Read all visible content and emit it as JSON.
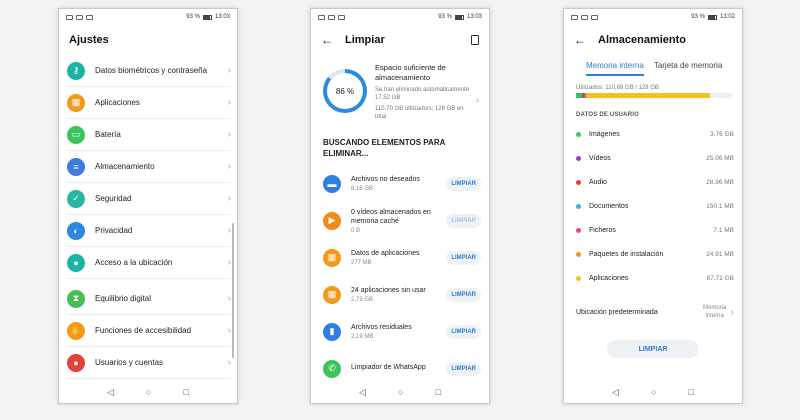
{
  "phone1": {
    "status_time": "13:03",
    "status_battery": "93 %",
    "title": "Ajustes",
    "items": [
      {
        "label": "Datos biométricos y contraseña",
        "icon": "key-icon",
        "color": "#1fb3a8"
      },
      {
        "label": "Aplicaciones",
        "icon": "apps-icon",
        "color": "#f39a1b"
      },
      {
        "label": "Batería",
        "icon": "battery-icon",
        "color": "#3cc45c"
      },
      {
        "label": "Almacenamiento",
        "icon": "storage-icon",
        "color": "#3d7be0"
      },
      {
        "label": "Seguridad",
        "icon": "shield-icon",
        "color": "#2bb5a3"
      },
      {
        "label": "Privacidad",
        "icon": "privacy-icon",
        "color": "#2f86e0"
      },
      {
        "label": "Acceso a la ubicación",
        "icon": "location-icon",
        "color": "#1fb3a8"
      },
      {
        "label": "Equilibrio digital",
        "icon": "hourglass-icon",
        "color": "#44bf55"
      },
      {
        "label": "Funciones de accesibilidad",
        "icon": "hand-icon",
        "color": "#f39a1b"
      },
      {
        "label": "Usuarios y cuentas",
        "icon": "user-icon",
        "color": "#e5413b"
      }
    ]
  },
  "phone2": {
    "status_time": "13:03",
    "status_battery": "93 %",
    "title": "Limpiar",
    "percent": "86 %",
    "summary_title": "Espacio suficiente de almacenamiento",
    "summary_sub1": "Se han eliminado automáticamente 17,52 GB",
    "summary_sub2": "110,70 GB utilizado/s; 128 GB en total",
    "section": "BUSCANDO ELEMENTOS PARA ELIMINAR...",
    "button_label": "LIMPIAR",
    "items": [
      {
        "label": "Archivos no deseados",
        "size": "8,16 GB",
        "icon": "folder-icon",
        "color": "#2f7fe0",
        "enabled": true
      },
      {
        "label": "0 vídeos almacenados en memoria caché",
        "size": "0 B",
        "icon": "video-icon",
        "color": "#f38b1b",
        "enabled": false
      },
      {
        "label": "Datos de aplicaciones",
        "size": "277 MB",
        "icon": "apps-icon",
        "color": "#f39a1b",
        "enabled": true
      },
      {
        "label": "24 aplicaciones sin usar",
        "size": "2,79 GB",
        "icon": "apps-icon",
        "color": "#f39a1b",
        "enabled": true
      },
      {
        "label": "Archivos residuales",
        "size": "2,19 MB",
        "icon": "trash-icon",
        "color": "#2f7fe0",
        "enabled": true
      },
      {
        "label": "Limpiador de WhatsApp",
        "size": "",
        "icon": "whatsapp-icon",
        "color": "#3cc45c",
        "enabled": true
      }
    ]
  },
  "phone3": {
    "status_time": "13:02",
    "status_battery": "93 %",
    "title": "Almacenamiento",
    "tab_internal": "Memoria interna",
    "tab_card": "Tarjeta de memoria",
    "used": "Utilizados: 110,69 GB / 128 GB",
    "user_data_head": "DATOS DE USUARIO",
    "items": [
      {
        "label": "Imágenes",
        "size": "3,76 GB",
        "color": "#3cc45c"
      },
      {
        "label": "Vídeos",
        "size": "25,06 MB",
        "color": "#9b3fc6"
      },
      {
        "label": "Audio",
        "size": "28,96 MB",
        "color": "#e5413b"
      },
      {
        "label": "Documentos",
        "size": "150,1 MB",
        "color": "#2fb5d8"
      },
      {
        "label": "Ficheros",
        "size": "7,1 MB",
        "color": "#e54d6b"
      },
      {
        "label": "Paquetes de instalación",
        "size": "24,91 MB",
        "color": "#f39a1b"
      },
      {
        "label": "Aplicaciones",
        "size": "87,71 GB",
        "color": "#f3c21b"
      }
    ],
    "bar_segments": [
      {
        "color": "#3cc45c",
        "fraction": 0.04
      },
      {
        "color": "#9b3fc6",
        "fraction": 0.01
      },
      {
        "color": "#e5413b",
        "fraction": 0.01
      },
      {
        "color": "#f39a1b",
        "fraction": 0.01
      },
      {
        "color": "#f3c21b",
        "fraction": 0.79
      }
    ],
    "location_label": "Ubicación predeterminada",
    "location_value": "Memoria interna",
    "button_label": "LIMPIAR"
  }
}
